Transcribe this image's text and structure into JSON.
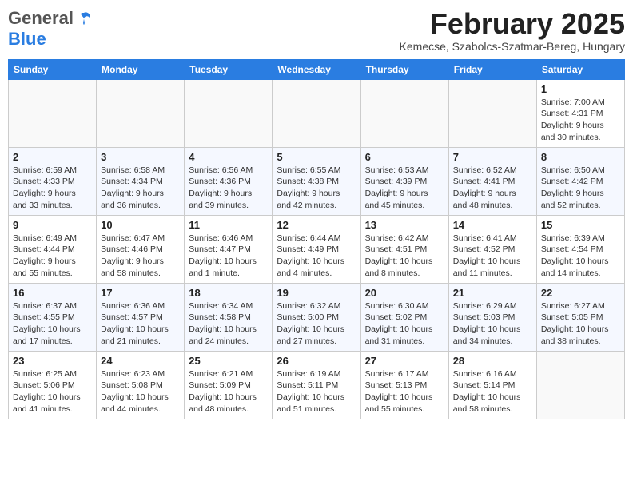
{
  "logo": {
    "general": "General",
    "blue": "Blue"
  },
  "header": {
    "month": "February 2025",
    "location": "Kemecse, Szabolcs-Szatmar-Bereg, Hungary"
  },
  "weekdays": [
    "Sunday",
    "Monday",
    "Tuesday",
    "Wednesday",
    "Thursday",
    "Friday",
    "Saturday"
  ],
  "weeks": [
    [
      {
        "day": "",
        "info": ""
      },
      {
        "day": "",
        "info": ""
      },
      {
        "day": "",
        "info": ""
      },
      {
        "day": "",
        "info": ""
      },
      {
        "day": "",
        "info": ""
      },
      {
        "day": "",
        "info": ""
      },
      {
        "day": "1",
        "info": "Sunrise: 7:00 AM\nSunset: 4:31 PM\nDaylight: 9 hours and 30 minutes."
      }
    ],
    [
      {
        "day": "2",
        "info": "Sunrise: 6:59 AM\nSunset: 4:33 PM\nDaylight: 9 hours and 33 minutes."
      },
      {
        "day": "3",
        "info": "Sunrise: 6:58 AM\nSunset: 4:34 PM\nDaylight: 9 hours and 36 minutes."
      },
      {
        "day": "4",
        "info": "Sunrise: 6:56 AM\nSunset: 4:36 PM\nDaylight: 9 hours and 39 minutes."
      },
      {
        "day": "5",
        "info": "Sunrise: 6:55 AM\nSunset: 4:38 PM\nDaylight: 9 hours and 42 minutes."
      },
      {
        "day": "6",
        "info": "Sunrise: 6:53 AM\nSunset: 4:39 PM\nDaylight: 9 hours and 45 minutes."
      },
      {
        "day": "7",
        "info": "Sunrise: 6:52 AM\nSunset: 4:41 PM\nDaylight: 9 hours and 48 minutes."
      },
      {
        "day": "8",
        "info": "Sunrise: 6:50 AM\nSunset: 4:42 PM\nDaylight: 9 hours and 52 minutes."
      }
    ],
    [
      {
        "day": "9",
        "info": "Sunrise: 6:49 AM\nSunset: 4:44 PM\nDaylight: 9 hours and 55 minutes."
      },
      {
        "day": "10",
        "info": "Sunrise: 6:47 AM\nSunset: 4:46 PM\nDaylight: 9 hours and 58 minutes."
      },
      {
        "day": "11",
        "info": "Sunrise: 6:46 AM\nSunset: 4:47 PM\nDaylight: 10 hours and 1 minute."
      },
      {
        "day": "12",
        "info": "Sunrise: 6:44 AM\nSunset: 4:49 PM\nDaylight: 10 hours and 4 minutes."
      },
      {
        "day": "13",
        "info": "Sunrise: 6:42 AM\nSunset: 4:51 PM\nDaylight: 10 hours and 8 minutes."
      },
      {
        "day": "14",
        "info": "Sunrise: 6:41 AM\nSunset: 4:52 PM\nDaylight: 10 hours and 11 minutes."
      },
      {
        "day": "15",
        "info": "Sunrise: 6:39 AM\nSunset: 4:54 PM\nDaylight: 10 hours and 14 minutes."
      }
    ],
    [
      {
        "day": "16",
        "info": "Sunrise: 6:37 AM\nSunset: 4:55 PM\nDaylight: 10 hours and 17 minutes."
      },
      {
        "day": "17",
        "info": "Sunrise: 6:36 AM\nSunset: 4:57 PM\nDaylight: 10 hours and 21 minutes."
      },
      {
        "day": "18",
        "info": "Sunrise: 6:34 AM\nSunset: 4:58 PM\nDaylight: 10 hours and 24 minutes."
      },
      {
        "day": "19",
        "info": "Sunrise: 6:32 AM\nSunset: 5:00 PM\nDaylight: 10 hours and 27 minutes."
      },
      {
        "day": "20",
        "info": "Sunrise: 6:30 AM\nSunset: 5:02 PM\nDaylight: 10 hours and 31 minutes."
      },
      {
        "day": "21",
        "info": "Sunrise: 6:29 AM\nSunset: 5:03 PM\nDaylight: 10 hours and 34 minutes."
      },
      {
        "day": "22",
        "info": "Sunrise: 6:27 AM\nSunset: 5:05 PM\nDaylight: 10 hours and 38 minutes."
      }
    ],
    [
      {
        "day": "23",
        "info": "Sunrise: 6:25 AM\nSunset: 5:06 PM\nDaylight: 10 hours and 41 minutes."
      },
      {
        "day": "24",
        "info": "Sunrise: 6:23 AM\nSunset: 5:08 PM\nDaylight: 10 hours and 44 minutes."
      },
      {
        "day": "25",
        "info": "Sunrise: 6:21 AM\nSunset: 5:09 PM\nDaylight: 10 hours and 48 minutes."
      },
      {
        "day": "26",
        "info": "Sunrise: 6:19 AM\nSunset: 5:11 PM\nDaylight: 10 hours and 51 minutes."
      },
      {
        "day": "27",
        "info": "Sunrise: 6:17 AM\nSunset: 5:13 PM\nDaylight: 10 hours and 55 minutes."
      },
      {
        "day": "28",
        "info": "Sunrise: 6:16 AM\nSunset: 5:14 PM\nDaylight: 10 hours and 58 minutes."
      },
      {
        "day": "",
        "info": ""
      }
    ]
  ]
}
